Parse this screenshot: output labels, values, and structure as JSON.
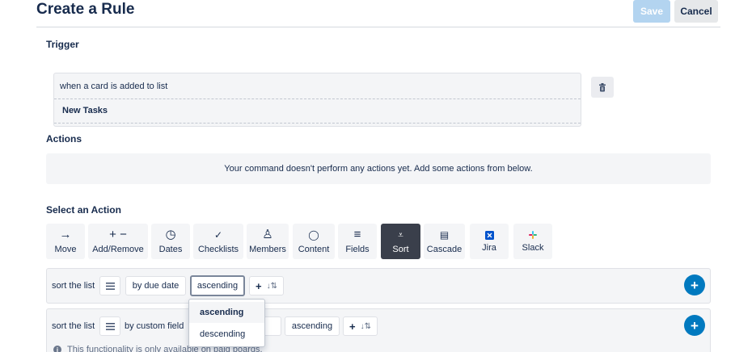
{
  "page": {
    "title": "Create a Rule",
    "save_label": "Save",
    "cancel_label": "Cancel"
  },
  "trigger": {
    "section_label": "Trigger",
    "line1": "when a card is added to list",
    "line2": "New Tasks",
    "delete_icon": "trash-icon"
  },
  "actions": {
    "section_label": "Actions",
    "empty_message": "Your command doesn't perform any actions yet. Add some actions from below."
  },
  "select_action": {
    "section_label": "Select an Action",
    "tabs": [
      {
        "label": "Move",
        "icon": "arrow-right-icon",
        "glyph": "→"
      },
      {
        "label": "Add/Remove",
        "icon": "plus-minus-icon",
        "glyph": "+ −"
      },
      {
        "label": "Dates",
        "icon": "clock-icon",
        "glyph": "◷"
      },
      {
        "label": "Checklists",
        "icon": "check-icon",
        "glyph": "✓"
      },
      {
        "label": "Members",
        "icon": "person-icon",
        "glyph": "♙"
      },
      {
        "label": "Content",
        "icon": "speech-bubble-icon",
        "glyph": "◯"
      },
      {
        "label": "Fields",
        "icon": "lines-icon",
        "glyph": "≡"
      },
      {
        "label": "Sort",
        "icon": "sort-filter-icon",
        "glyph": "⩡"
      },
      {
        "label": "Cascade",
        "icon": "cascade-icon",
        "glyph": "▤"
      },
      {
        "label": "Jira",
        "icon": "jira-icon",
        "glyph": "◆"
      },
      {
        "label": "Slack",
        "icon": "slack-icon",
        "glyph": "✣"
      }
    ],
    "active_tab": "Sort"
  },
  "sort_rows": [
    {
      "prefix": "sort the list",
      "list_icon": "list-icon",
      "field": "by due date",
      "order": "ascending",
      "add_glyph": "+",
      "sort_glyph": "↓⇅"
    },
    {
      "prefix": "sort the list",
      "list_icon": "list-icon",
      "field": "by custom field",
      "order": "ascending",
      "add_glyph": "+",
      "sort_glyph": "↓⇅",
      "notice": "This functionality is only available on paid boards."
    }
  ],
  "order_dropdown": {
    "options": [
      "ascending",
      "descending"
    ],
    "selected": "ascending"
  },
  "colors": {
    "primary": "#0079bf",
    "save_disabled": "#b3d4f0",
    "active_tab": "#3a3f4b",
    "panel_bg": "#f4f5f7"
  }
}
